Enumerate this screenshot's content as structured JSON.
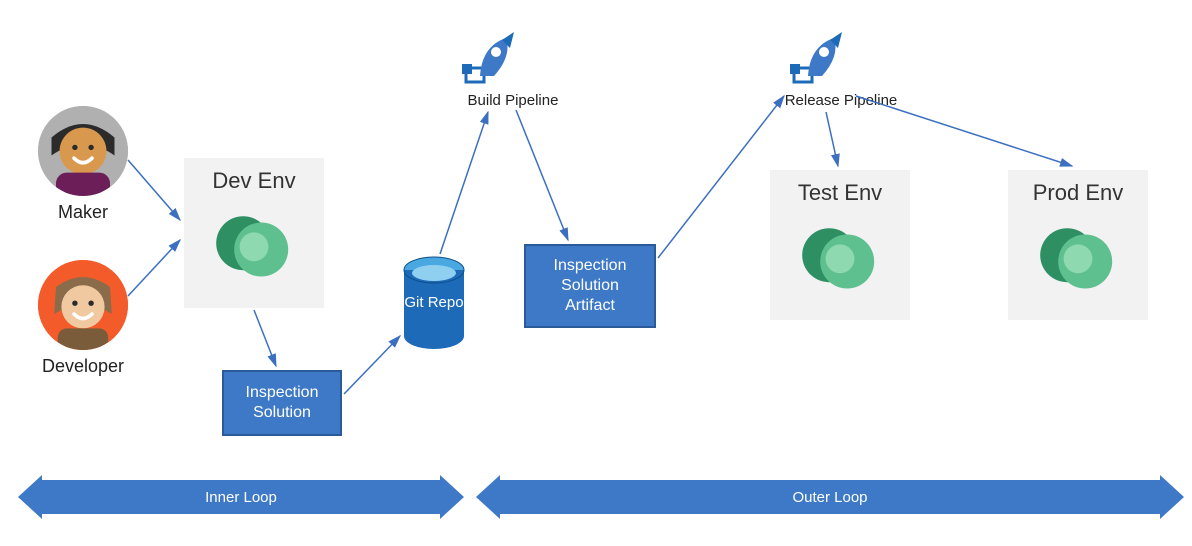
{
  "personas": {
    "maker": "Maker",
    "developer": "Developer"
  },
  "envs": {
    "dev": "Dev Env",
    "test": "Test Env",
    "prod": "Prod Env"
  },
  "boxes": {
    "inspection_solution": "Inspection\nSolution",
    "git_repo": "Git\nRepo",
    "inspection_artifact": "Inspection\nSolution\nArtifact"
  },
  "pipelines": {
    "build": "Build Pipeline",
    "release": "Release Pipeline"
  },
  "loops": {
    "inner": "Inner Loop",
    "outer": "Outer Loop"
  },
  "colors": {
    "blue": "#3d79c7",
    "border_blue": "#2b5a99",
    "arrow": "#3b6fc0",
    "env_bg": "#f2f2f2",
    "green1": "#2e8f62",
    "green2": "#5fc08f",
    "green3": "#8fd9b0"
  }
}
